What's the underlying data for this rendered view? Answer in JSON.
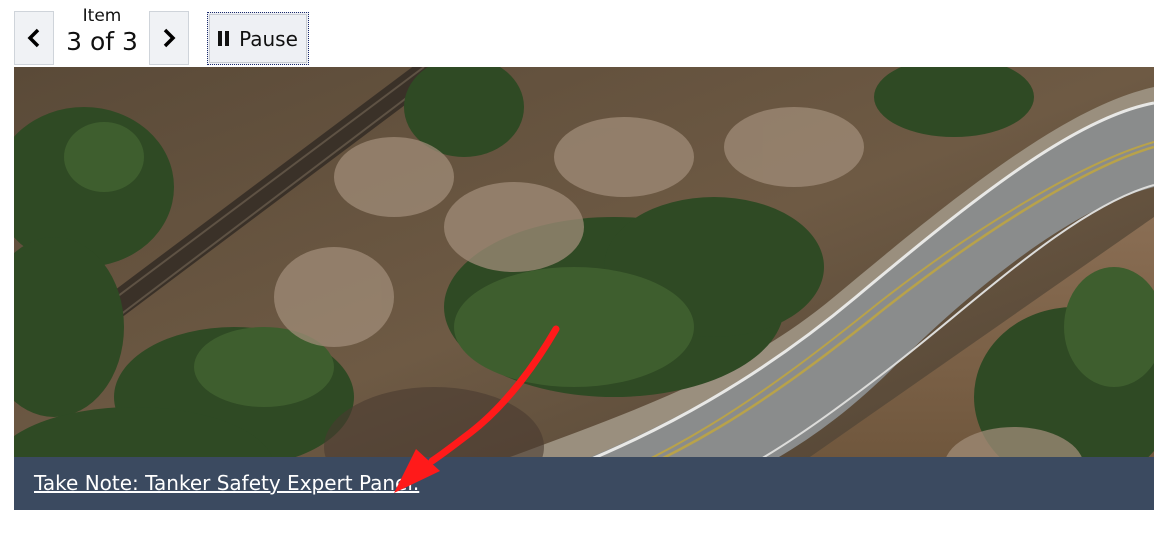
{
  "carousel": {
    "prev_icon": "chevron-left-icon",
    "next_icon": "chevron-right-icon",
    "counter_label": "Item",
    "counter_value": "3 of 3",
    "pause_label": "Pause",
    "pause_icon": "pause-icon"
  },
  "slide": {
    "caption": "Take Note: Tanker Safety Expert Panel.",
    "caption_bar_color": "#3b4a60",
    "annotation_arrow_color": "#ff1a1a"
  }
}
